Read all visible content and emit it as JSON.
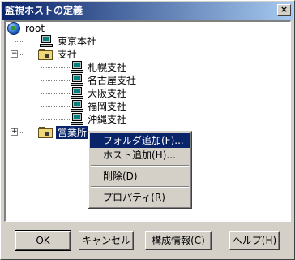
{
  "window": {
    "title": "監視ホストの定義",
    "close_glyph": "×"
  },
  "tree": {
    "root": {
      "label": "root",
      "icon": "globe-icon"
    },
    "nodes": [
      {
        "label": "東京本社",
        "icon": "computer-icon"
      },
      {
        "label": "支社",
        "icon": "folder-icon",
        "expander": "−"
      },
      {
        "label": "札幌支社",
        "icon": "computer-icon"
      },
      {
        "label": "名古屋支社",
        "icon": "computer-icon"
      },
      {
        "label": "大阪支社",
        "icon": "computer-icon"
      },
      {
        "label": "福岡支社",
        "icon": "computer-icon"
      },
      {
        "label": "沖縄支社",
        "icon": "computer-icon"
      },
      {
        "label": "営業所",
        "icon": "folder-icon",
        "expander": "+",
        "selected": true
      }
    ]
  },
  "context_menu": {
    "items": [
      {
        "label": "フォルダ追加(F)...",
        "highlighted": true
      },
      {
        "label": "ホスト追加(H)..."
      },
      {
        "label": "削除(D)"
      },
      {
        "label": "プロパティ(R)"
      }
    ]
  },
  "buttons": {
    "ok": "OK",
    "cancel": "キャンセル",
    "config": "構成情報(C)",
    "help": "ヘルプ(H)"
  }
}
